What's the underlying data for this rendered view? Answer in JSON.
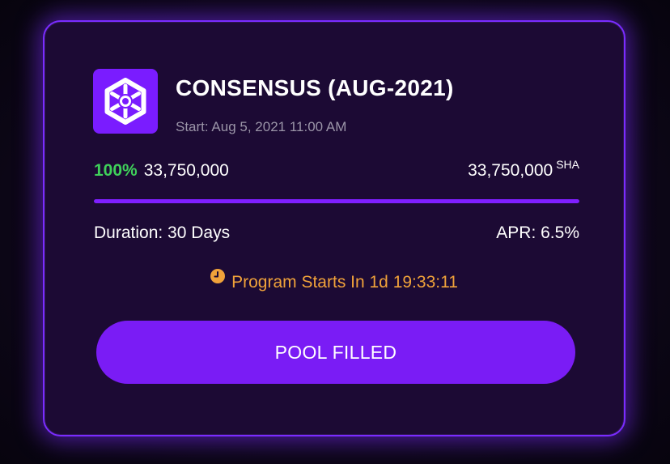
{
  "card": {
    "title": "CONSENSUS (AUG-2021)",
    "start": "Start: Aug 5, 2021 11:00 AM",
    "logo_icon": "hexagon-network-icon",
    "progress": {
      "percent_label": "100%",
      "filled_amount": "33,750,000",
      "total_amount": "33,750,000",
      "unit": "SHA",
      "fraction": 1.0
    },
    "duration": "Duration: 30 Days",
    "apr": "APR: 6.5%",
    "countdown": "Program Starts In 1d 19:33:11",
    "countdown_icon": "clock-icon",
    "button_label": "POOL FILLED"
  },
  "colors": {
    "accent": "#7a1cff",
    "success": "#3fd05a",
    "warning": "#f0a23a",
    "card_bg": "#1c0a34"
  }
}
